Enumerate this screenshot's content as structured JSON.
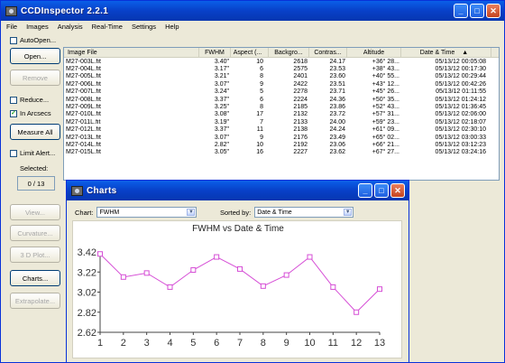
{
  "app": {
    "title": "CCDInspector 2.2.1",
    "menu": [
      "File",
      "Images",
      "Analysis",
      "Real-Time",
      "Settings",
      "Help"
    ],
    "window_buttons": [
      "_",
      "□",
      "✕"
    ]
  },
  "left_panel": {
    "auto_open": {
      "label": "AutoOpen...",
      "checked": false
    },
    "open_btn": "Open...",
    "remove_btn": "Remove",
    "reduce": {
      "label": "Reduce...",
      "checked": false
    },
    "in_arcsecs": {
      "label": "In Arcsecs",
      "checked": true
    },
    "measure_all_btn": "Measure All",
    "limit_alert": {
      "label": "Limit Alert...",
      "checked": false
    },
    "selected_label": "Selected:",
    "selected_value": "0 / 13",
    "view_btn": "View...",
    "curvature_btn": "Curvature...",
    "plot3d_btn": "3 D Plot...",
    "charts_btn": "Charts...",
    "extrapolate_btn": "Extrapolate..."
  },
  "table": {
    "columns": [
      "Image File",
      "FWHM",
      "Aspect (...",
      "Backgro...",
      "Contras...",
      "Altitude",
      "Date & Time"
    ],
    "sort_indicator": "▲",
    "rows": [
      [
        "M27-003L.fit",
        "3.40\"",
        "10",
        "2618",
        "24.17",
        "+36° 28...",
        "05/13/12 00:05:08"
      ],
      [
        "M27-004L.fit",
        "3.17\"",
        "6",
        "2575",
        "23.53",
        "+38° 43...",
        "05/13/12 00:17:30"
      ],
      [
        "M27-005L.fit",
        "3.21\"",
        "8",
        "2401",
        "23.60",
        "+40° 55...",
        "05/13/12 00:29:44"
      ],
      [
        "M27-006L.fit",
        "3.07\"",
        "9",
        "2422",
        "23.51",
        "+43° 12...",
        "05/13/12 00:42:26"
      ],
      [
        "M27-007L.fit",
        "3.24\"",
        "5",
        "2278",
        "23.71",
        "+45° 26...",
        "05/13/12 01:11:55"
      ],
      [
        "M27-008L.fit",
        "3.37\"",
        "6",
        "2224",
        "24.36",
        "+50° 35...",
        "05/13/12 01:24:12"
      ],
      [
        "M27-009L.fit",
        "3.25\"",
        "8",
        "2185",
        "23.86",
        "+52° 43...",
        "05/13/12 01:36:45"
      ],
      [
        "M27-010L.fit",
        "3.08\"",
        "17",
        "2132",
        "23.72",
        "+57° 31...",
        "05/13/12 02:06:00"
      ],
      [
        "M27-011L.fit",
        "3.19\"",
        "7",
        "2133",
        "24.00",
        "+59° 23...",
        "05/13/12 02:18:07"
      ],
      [
        "M27-012L.fit",
        "3.37\"",
        "11",
        "2138",
        "24.24",
        "+61° 09...",
        "05/13/12 02:30:10"
      ],
      [
        "M27-013L.fit",
        "3.07\"",
        "9",
        "2176",
        "23.49",
        "+65° 02...",
        "05/13/12 03:00:33"
      ],
      [
        "M27-014L.fit",
        "2.82\"",
        "10",
        "2192",
        "23.06",
        "+66° 21...",
        "05/13/12 03:12:23"
      ],
      [
        "M27-015L.fit",
        "3.05\"",
        "16",
        "2227",
        "23.62",
        "+67° 27...",
        "05/13/12 03:24:16"
      ]
    ]
  },
  "charts_window": {
    "title": "Charts",
    "chart_label": "Chart:",
    "chart_value": "FWHM",
    "sorted_label": "Sorted by:",
    "sorted_value": "Date & Time"
  },
  "chart_data": {
    "type": "line",
    "title": "FWHM vs  Date & Time",
    "x": [
      1,
      2,
      3,
      4,
      5,
      6,
      7,
      8,
      9,
      10,
      11,
      12,
      13
    ],
    "values": [
      3.4,
      3.17,
      3.21,
      3.07,
      3.24,
      3.37,
      3.25,
      3.08,
      3.19,
      3.37,
      3.07,
      2.82,
      3.05
    ],
    "yticks": [
      "3.42",
      "3.22",
      "3.02",
      "2.82",
      "2.62"
    ],
    "ylim": [
      2.62,
      3.42
    ],
    "xlim": [
      1,
      13
    ],
    "grid": false,
    "line_color": "#d64fd6",
    "marker": "square"
  }
}
